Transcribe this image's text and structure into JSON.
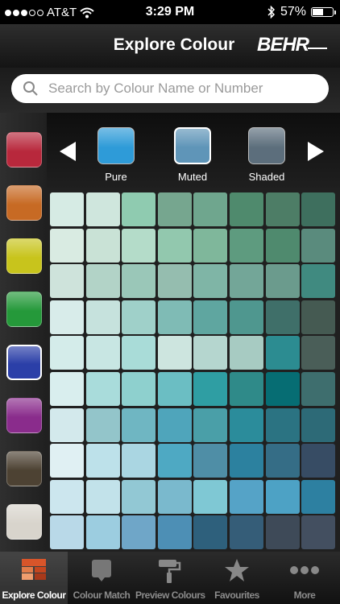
{
  "status_bar": {
    "carrier": "AT&T",
    "time": "3:29 PM",
    "battery_percent": "57%",
    "battery_level": 0.57
  },
  "header": {
    "title": "Explore Colour",
    "logo": "BEHR"
  },
  "search": {
    "placeholder": "Search by Colour Name or Number"
  },
  "colour_families": [
    {
      "name": "red",
      "color": "#b8283c"
    },
    {
      "name": "orange",
      "color": "#c76a24"
    },
    {
      "name": "yellow",
      "color": "#c8c41c"
    },
    {
      "name": "green",
      "color": "#25993a"
    },
    {
      "name": "blue",
      "color": "#2b3fa8",
      "selected": true
    },
    {
      "name": "purple",
      "color": "#8a2c8c"
    },
    {
      "name": "brown",
      "color": "#4d4233"
    },
    {
      "name": "neutral",
      "color": "#d8d4cc"
    }
  ],
  "tones": [
    {
      "label": "Pure",
      "color": "#2e9bd8"
    },
    {
      "label": "Muted",
      "color": "#5f95b8",
      "selected": true
    },
    {
      "label": "Shaded",
      "color": "#5c6e7c"
    }
  ],
  "grid_colors": [
    [
      "#d6ebe4",
      "#cfe6dd",
      "#8fcbb0",
      "#76a68f",
      "#6fa68e",
      "#4f8a6d",
      "#4d7d66",
      "#3e6f5e"
    ],
    [
      "#d9ebe2",
      "#c9e2d6",
      "#b4dcc9",
      "#92c8ae",
      "#7fb79b",
      "#5e9b7f",
      "#4f8a6e",
      "#5a8b7d"
    ],
    [
      "#cee3db",
      "#b2d3c7",
      "#9ac7b8",
      "#95bdaf",
      "#7fb5a6",
      "#73a698",
      "#6b9b8d",
      "#408a80"
    ],
    [
      "#d8ecea",
      "#c6e2dd",
      "#9fd0c9",
      "#7fbbb5",
      "#5fa6a0",
      "#4f978f",
      "#3f6f69",
      "#455a52"
    ],
    [
      "#d4ecea",
      "#c8e6e3",
      "#a9dcd8",
      "#cde5df",
      "#b5d6cf",
      "#a7cbc2",
      "#2c8c91",
      "#4a5e58"
    ],
    [
      "#d9eeee",
      "#a9dcdb",
      "#8ed0ce",
      "#6bbec3",
      "#2f9ea3",
      "#2f8a89",
      "#066d73",
      "#3e6e6e"
    ],
    [
      "#d3e9ec",
      "#93c5ca",
      "#6fb6c2",
      "#4fa5bb",
      "#4a9fa8",
      "#2b8c9b",
      "#2b7382",
      "#2d6a77"
    ],
    [
      "#e0f0f3",
      "#bde1ea",
      "#aad6e2",
      "#4ea9c3",
      "#4f8ea6",
      "#2c819f",
      "#356d86",
      "#374c64"
    ],
    [
      "#cce6ee",
      "#c2e2ea",
      "#92c8d4",
      "#7ab9cd",
      "#7fc8d4",
      "#55a3c7",
      "#4da2c5",
      "#2d80a1"
    ],
    [
      "#b9d9e8",
      "#9ccde0",
      "#6fa6c8",
      "#4d8fb5",
      "#2e607c",
      "#355d78",
      "#3e4a58",
      "#434f60"
    ]
  ],
  "tabs": [
    {
      "label": "Explore Colour",
      "icon": "explore-colour-icon",
      "active": true
    },
    {
      "label": "Colour Match",
      "icon": "colour-match-icon"
    },
    {
      "label": "Preview Colours",
      "icon": "paint-roller-icon"
    },
    {
      "label": "Favourites",
      "icon": "star-icon"
    },
    {
      "label": "More",
      "icon": "more-icon"
    }
  ]
}
